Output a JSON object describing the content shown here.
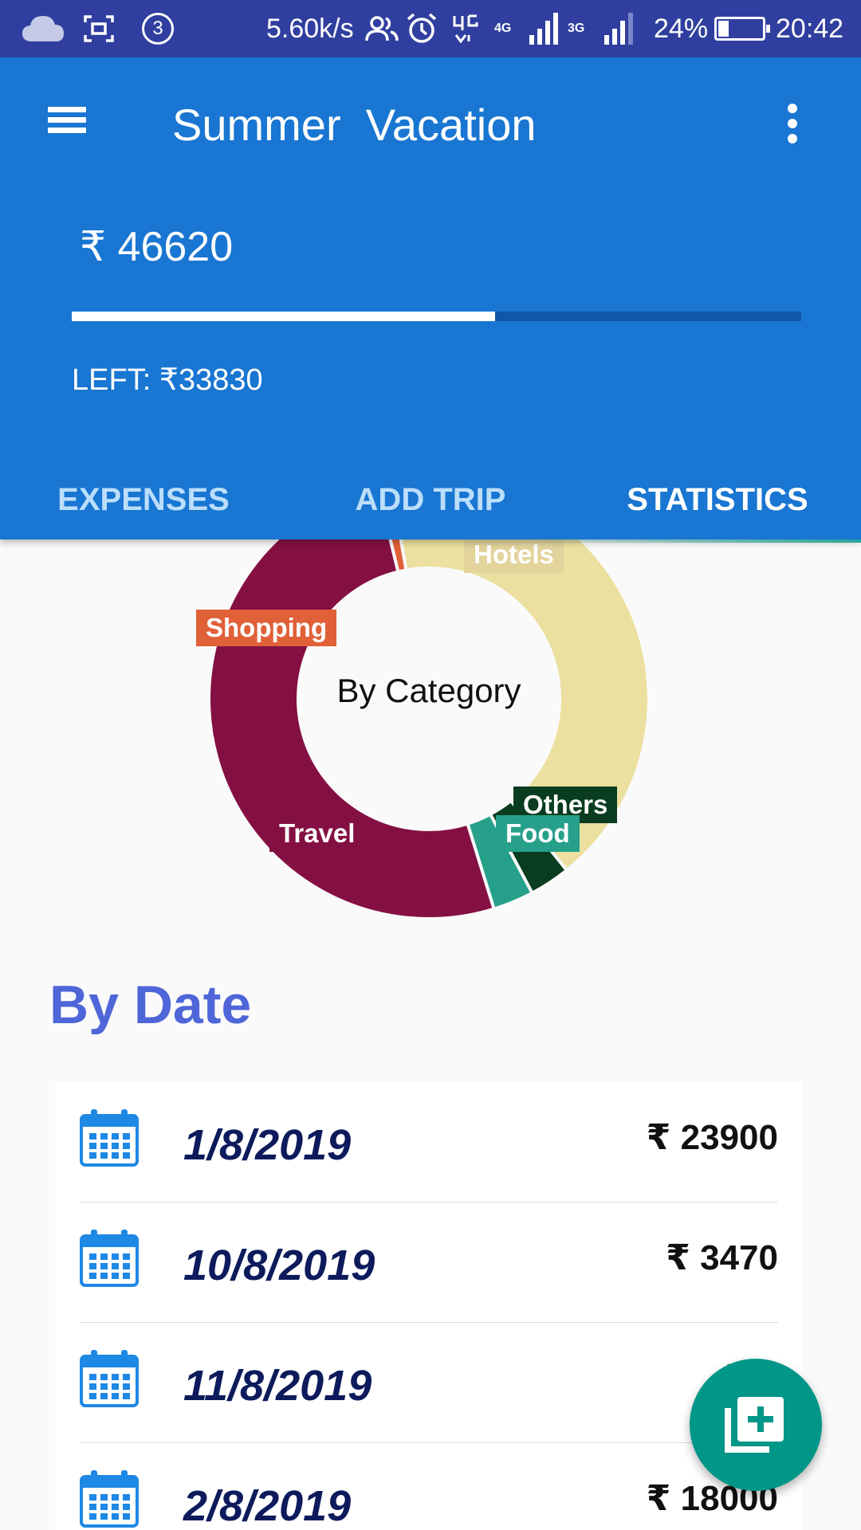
{
  "status_bar": {
    "notification_count": "3",
    "network_speed": "5.60k/s",
    "net_4g_label": "4G",
    "net_3g_label": "3G",
    "battery_percent": "24%",
    "battery_level": 0.24,
    "time": "20:42",
    "icons": [
      "cloud-icon",
      "screenshot-icon",
      "contacts-icon",
      "alarm-icon",
      "volte-icon",
      "signal-icon",
      "battery-icon"
    ]
  },
  "app_bar": {
    "title": "Summer  Vacation",
    "total_amount": "₹ 46620",
    "spent_fraction": 0.58,
    "left_text": "LEFT: ₹33830"
  },
  "tabs": [
    {
      "label": "EXPENSES",
      "active": false
    },
    {
      "label": "ADD TRIP",
      "active": false
    },
    {
      "label": "STATISTICS",
      "active": true
    }
  ],
  "chart_data": {
    "type": "pie",
    "title": "By Category",
    "categories": [
      "Hotels",
      "Others",
      "Food",
      "Travel",
      "Shopping"
    ],
    "values": [
      42,
      3,
      3,
      51,
      1
    ],
    "colors": [
      "#ece0a0",
      "#0a3d1f",
      "#26a08a",
      "#841043",
      "#e06038"
    ]
  },
  "by_date": {
    "heading": "By Date",
    "rows": [
      {
        "date": "1/8/2019",
        "amount": "₹ 23900"
      },
      {
        "date": "10/8/2019",
        "amount": "₹ 3470"
      },
      {
        "date": "11/8/2019",
        "amount": "₹ 1"
      },
      {
        "date": "2/8/2019",
        "amount": "₹ 18000"
      }
    ]
  },
  "colors": {
    "status_bar": "#303f9f",
    "app_bar": "#1976d2",
    "accent": "#009688",
    "heading": "#4f66d9"
  }
}
